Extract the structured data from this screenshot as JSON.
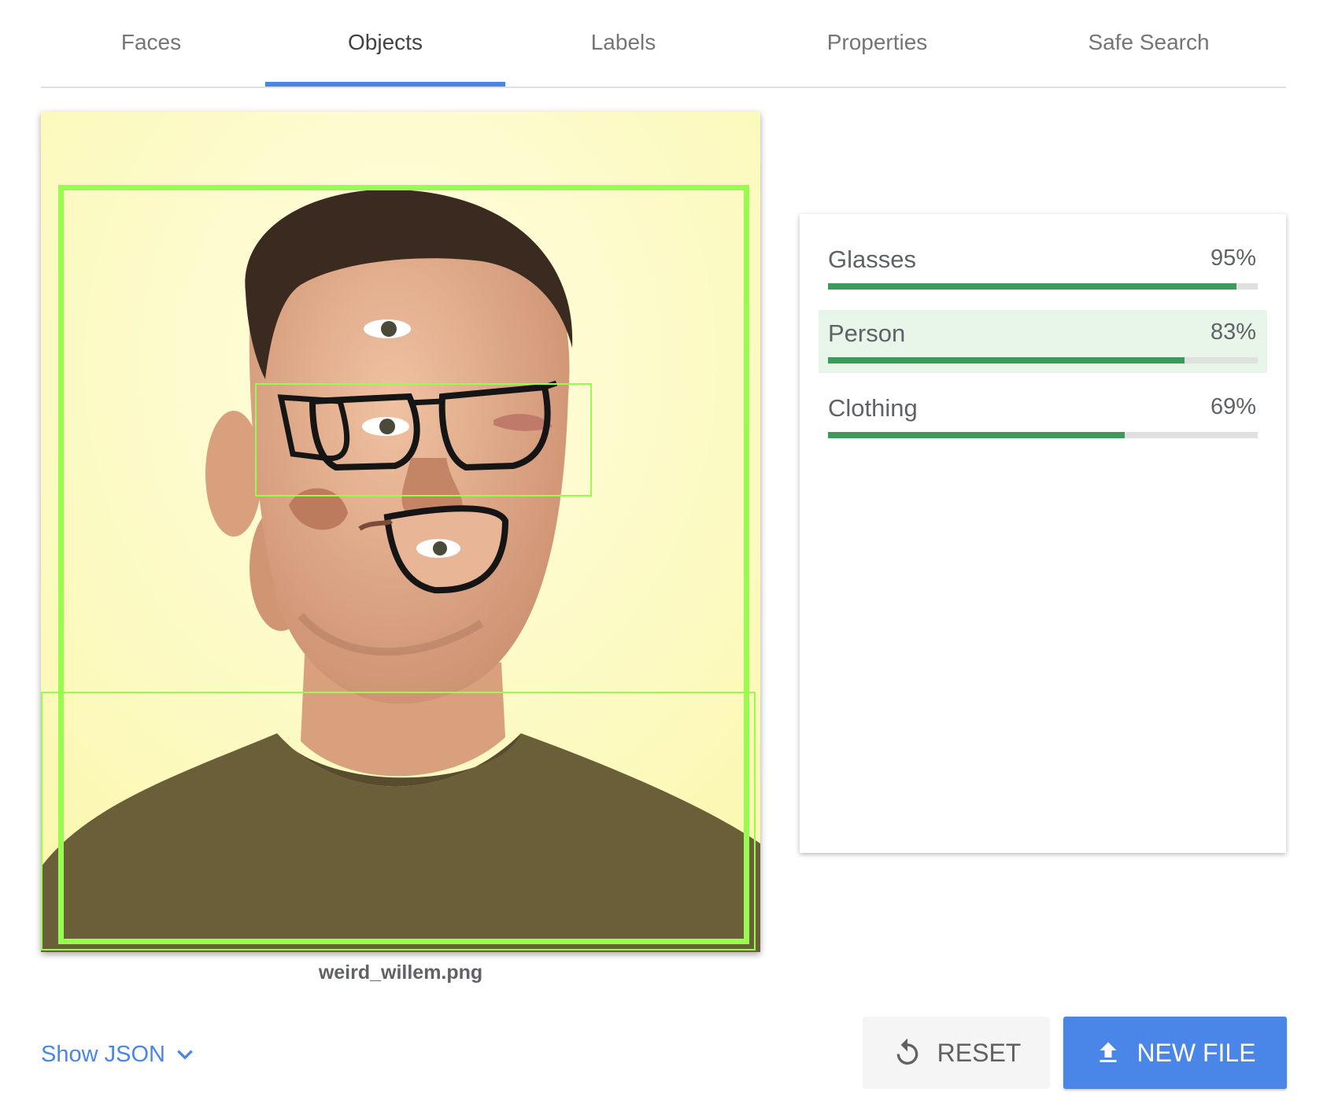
{
  "tabs": [
    {
      "label": "Faces",
      "active": false
    },
    {
      "label": "Objects",
      "active": true
    },
    {
      "label": "Labels",
      "active": false
    },
    {
      "label": "Properties",
      "active": false
    },
    {
      "label": "Safe Search",
      "active": false
    }
  ],
  "image": {
    "file_name": "weird_willem.png",
    "bounding_boxes": [
      "Person",
      "Glasses",
      "Clothing"
    ],
    "box_color": "#98fb4f"
  },
  "results": [
    {
      "label": "Glasses",
      "score": "95%",
      "value": 0.95
    },
    {
      "label": "Person",
      "score": "83%",
      "value": 0.83,
      "highlighted": true
    },
    {
      "label": "Clothing",
      "score": "69%",
      "value": 0.69
    }
  ],
  "controls": {
    "show_json": "Show JSON",
    "reset": "RESET",
    "new_file": "NEW FILE"
  },
  "colors": {
    "accent": "#4a86e8",
    "bar_fill": "#3d9a5b",
    "row_highlight": "#e8f5e9"
  },
  "icons": {
    "show_json": "chevron-down-icon",
    "reset": "reset-icon",
    "new_file": "upload-icon"
  }
}
